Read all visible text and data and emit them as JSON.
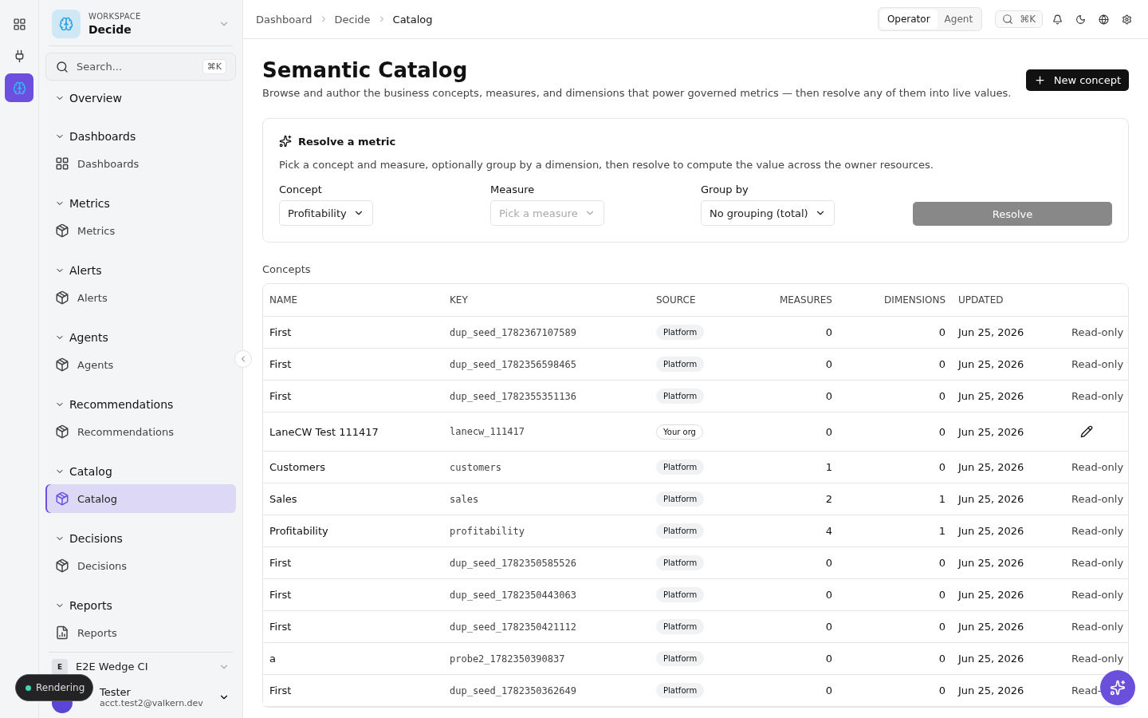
{
  "rail": [
    {
      "kind": "grid",
      "selected": false
    },
    {
      "kind": "plug",
      "selected": false
    },
    {
      "kind": "brain",
      "selected": true
    }
  ],
  "workspace": {
    "label": "WORKSPACE",
    "name": "Decide"
  },
  "search": {
    "placeholder": "Search...",
    "shortcut": "⌘K"
  },
  "nav": [
    {
      "title": "Overview",
      "expanded": true
    },
    {
      "title": "Dashboards",
      "expanded": true,
      "items": [
        {
          "label": "Dashboards",
          "kind": "grid",
          "selected": false
        }
      ]
    },
    {
      "title": "Metrics",
      "expanded": true,
      "items": [
        {
          "label": "Metrics",
          "kind": "box",
          "selected": false
        }
      ]
    },
    {
      "title": "Alerts",
      "expanded": true,
      "items": [
        {
          "label": "Alerts",
          "kind": "box",
          "selected": false
        }
      ]
    },
    {
      "title": "Agents",
      "expanded": true,
      "items": [
        {
          "label": "Agents",
          "kind": "box",
          "selected": false
        }
      ]
    },
    {
      "title": "Recommendations",
      "expanded": true,
      "items": [
        {
          "label": "Recommendations",
          "kind": "box",
          "selected": false
        }
      ]
    },
    {
      "title": "Catalog",
      "expanded": true,
      "items": [
        {
          "label": "Catalog",
          "kind": "box",
          "selected": true
        }
      ]
    },
    {
      "title": "Decisions",
      "expanded": true,
      "items": [
        {
          "label": "Decisions",
          "kind": "box",
          "selected": false
        }
      ]
    },
    {
      "title": "Reports",
      "expanded": true,
      "items": [
        {
          "label": "Reports",
          "kind": "report",
          "selected": false
        }
      ]
    }
  ],
  "org": {
    "initial": "E",
    "name": "E2E Wedge CI"
  },
  "user": {
    "name": "Tester",
    "email": "acct.test2@valkern.dev"
  },
  "toast": {
    "text": "Rendering"
  },
  "breadcrumb": [
    "Dashboard",
    "Decide",
    "Catalog"
  ],
  "modes": [
    {
      "label": "Operator",
      "selected": true
    },
    {
      "label": "Agent",
      "selected": false
    }
  ],
  "command": {
    "shortcut": "⌘K"
  },
  "page": {
    "title": "Semantic Catalog",
    "subtitle": "Browse and author the business concepts, measures, and dimensions that power governed metrics — then resolve any of them into live values.",
    "action": "New concept"
  },
  "resolver": {
    "title": "Resolve a metric",
    "description": "Pick a concept and measure, optionally group by a dimension, then resolve to compute the value across the owner resources.",
    "fields": [
      {
        "label": "Concept",
        "value": "Profitability",
        "disabled": false
      },
      {
        "label": "Measure",
        "placeholder": "Pick a measure",
        "disabled": true
      },
      {
        "label": "Group by",
        "value": "No grouping (total)",
        "disabled": false
      }
    ],
    "button": {
      "label": "Resolve",
      "disabled": true
    }
  },
  "table": {
    "caption": "Concepts",
    "columns": [
      "NAME",
      "KEY",
      "SOURCE",
      "MEASURES",
      "DIMENSIONS",
      "UPDATED"
    ],
    "rows": [
      {
        "name": "First",
        "key": "dup_seed_1782367107589",
        "source": {
          "text": "Platform",
          "kind": "platform"
        },
        "measures": "0",
        "dimensions": "0",
        "updated": "Jun 25, 2026",
        "access": {
          "kind": "readonly",
          "text": "Read-only"
        }
      },
      {
        "name": "First",
        "key": "dup_seed_1782356598465",
        "source": {
          "text": "Platform",
          "kind": "platform"
        },
        "measures": "0",
        "dimensions": "0",
        "updated": "Jun 25, 2026",
        "access": {
          "kind": "readonly",
          "text": "Read-only"
        }
      },
      {
        "name": "First",
        "key": "dup_seed_1782355351136",
        "source": {
          "text": "Platform",
          "kind": "platform"
        },
        "measures": "0",
        "dimensions": "0",
        "updated": "Jun 25, 2026",
        "access": {
          "kind": "readonly",
          "text": "Read-only"
        }
      },
      {
        "name": "LaneCW Test 111417",
        "key": "lanecw_111417",
        "source": {
          "text": "Your org",
          "kind": "org"
        },
        "measures": "0",
        "dimensions": "0",
        "updated": "Jun 25, 2026",
        "access": {
          "kind": "edit"
        }
      },
      {
        "name": "Customers",
        "key": "customers",
        "source": {
          "text": "Platform",
          "kind": "platform"
        },
        "measures": "1",
        "dimensions": "0",
        "updated": "Jun 25, 2026",
        "access": {
          "kind": "readonly",
          "text": "Read-only"
        }
      },
      {
        "name": "Sales",
        "key": "sales",
        "source": {
          "text": "Platform",
          "kind": "platform"
        },
        "measures": "2",
        "dimensions": "1",
        "updated": "Jun 25, 2026",
        "access": {
          "kind": "readonly",
          "text": "Read-only"
        }
      },
      {
        "name": "Profitability",
        "key": "profitability",
        "source": {
          "text": "Platform",
          "kind": "platform"
        },
        "measures": "4",
        "dimensions": "1",
        "updated": "Jun 25, 2026",
        "access": {
          "kind": "readonly",
          "text": "Read-only"
        }
      },
      {
        "name": "First",
        "key": "dup_seed_1782350585526",
        "source": {
          "text": "Platform",
          "kind": "platform"
        },
        "measures": "0",
        "dimensions": "0",
        "updated": "Jun 25, 2026",
        "access": {
          "kind": "readonly",
          "text": "Read-only"
        }
      },
      {
        "name": "First",
        "key": "dup_seed_1782350443063",
        "source": {
          "text": "Platform",
          "kind": "platform"
        },
        "measures": "0",
        "dimensions": "0",
        "updated": "Jun 25, 2026",
        "access": {
          "kind": "readonly",
          "text": "Read-only"
        }
      },
      {
        "name": "First",
        "key": "dup_seed_1782350421112",
        "source": {
          "text": "Platform",
          "kind": "platform"
        },
        "measures": "0",
        "dimensions": "0",
        "updated": "Jun 25, 2026",
        "access": {
          "kind": "readonly",
          "text": "Read-only"
        }
      },
      {
        "name": "a",
        "key": "probe2_1782350390837",
        "source": {
          "text": "Platform",
          "kind": "platform"
        },
        "measures": "0",
        "dimensions": "0",
        "updated": "Jun 25, 2026",
        "access": {
          "kind": "readonly",
          "text": "Read-only"
        }
      },
      {
        "name": "First",
        "key": "dup_seed_1782350362649",
        "source": {
          "text": "Platform",
          "kind": "platform"
        },
        "measures": "0",
        "dimensions": "0",
        "updated": "Jun 25, 2026",
        "access": {
          "kind": "readonly",
          "text": "Read-"
        }
      }
    ]
  }
}
